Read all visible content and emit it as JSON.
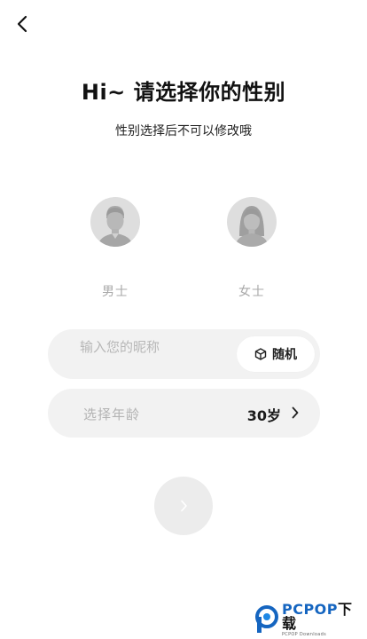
{
  "header": {
    "title": "Hi~ 请选择你的性别",
    "subtitle": "性别选择后不可以修改哦"
  },
  "gender_options": [
    {
      "label": "男士",
      "icon": "male-avatar-icon"
    },
    {
      "label": "女士",
      "icon": "female-avatar-icon"
    }
  ],
  "nickname": {
    "placeholder": "输入您的昵称",
    "value": "",
    "random_label": "随机",
    "random_icon": "dice-icon"
  },
  "age": {
    "label": "选择年龄",
    "value": "30岁"
  },
  "next_icon": "chevron-right-icon",
  "back_icon": "back-arrow-icon",
  "watermark": {
    "name_latin": "PCPOP",
    "name_cn": "下载",
    "sub": "PCPOP Downloads"
  },
  "colors": {
    "background": "#ffffff",
    "field_background": "#f2f2f2",
    "avatar_background": "#dedede",
    "next_button": "#ececec",
    "watermark_blue": "#1565c0"
  }
}
